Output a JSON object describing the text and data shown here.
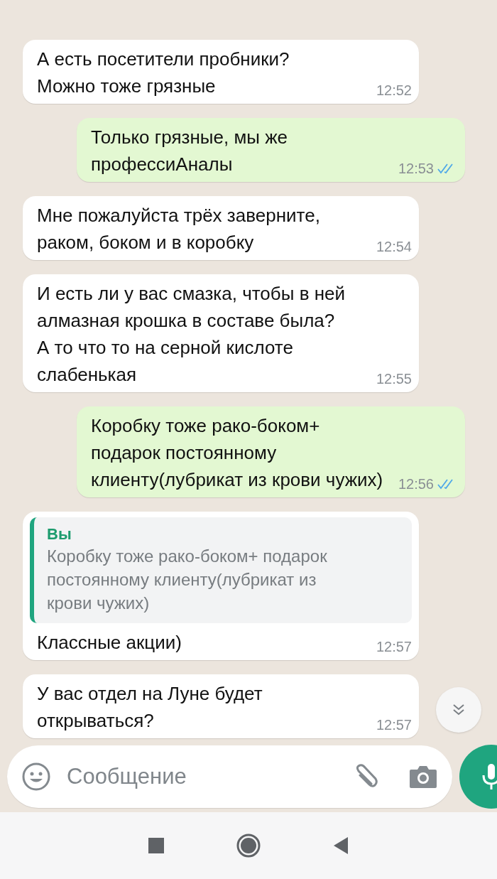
{
  "messages": [
    {
      "kind": "text",
      "outgoing": false,
      "text": "А есть посетители пробники?\nМожно тоже грязные",
      "time": "12:52"
    },
    {
      "kind": "text",
      "outgoing": true,
      "text": "Только грязные, мы же\nпрофессиАналы",
      "time": "12:53",
      "read": true
    },
    {
      "kind": "text",
      "outgoing": false,
      "text": "Мне пожалуйста трёх заверните,\nраком, боком и в коробку",
      "time": "12:54"
    },
    {
      "kind": "text",
      "outgoing": false,
      "text": "И есть ли у вас смазка, чтобы в ней\nалмазная крошка в составе была?\nА то что то на серной кислоте\nслабенькая",
      "time": "12:55"
    },
    {
      "kind": "text",
      "outgoing": true,
      "text": "Коробку тоже рако-боком+\nподарок постоянному\nклиенту(лубрикат из крови чужих)",
      "time": "12:56",
      "read": true
    },
    {
      "kind": "reply",
      "outgoing": false,
      "quote_author": "Вы",
      "quote_text": "Коробку тоже рако-боком+ подарок\nпостоянному клиенту(лубрикат из\nкрови чужих)",
      "text": "Классные акции)",
      "time": "12:57"
    },
    {
      "kind": "text",
      "outgoing": false,
      "text": "У вас отдел на Луне будет\nоткрываться?",
      "time": "12:57"
    }
  ],
  "composer": {
    "placeholder": "Сообщение"
  }
}
